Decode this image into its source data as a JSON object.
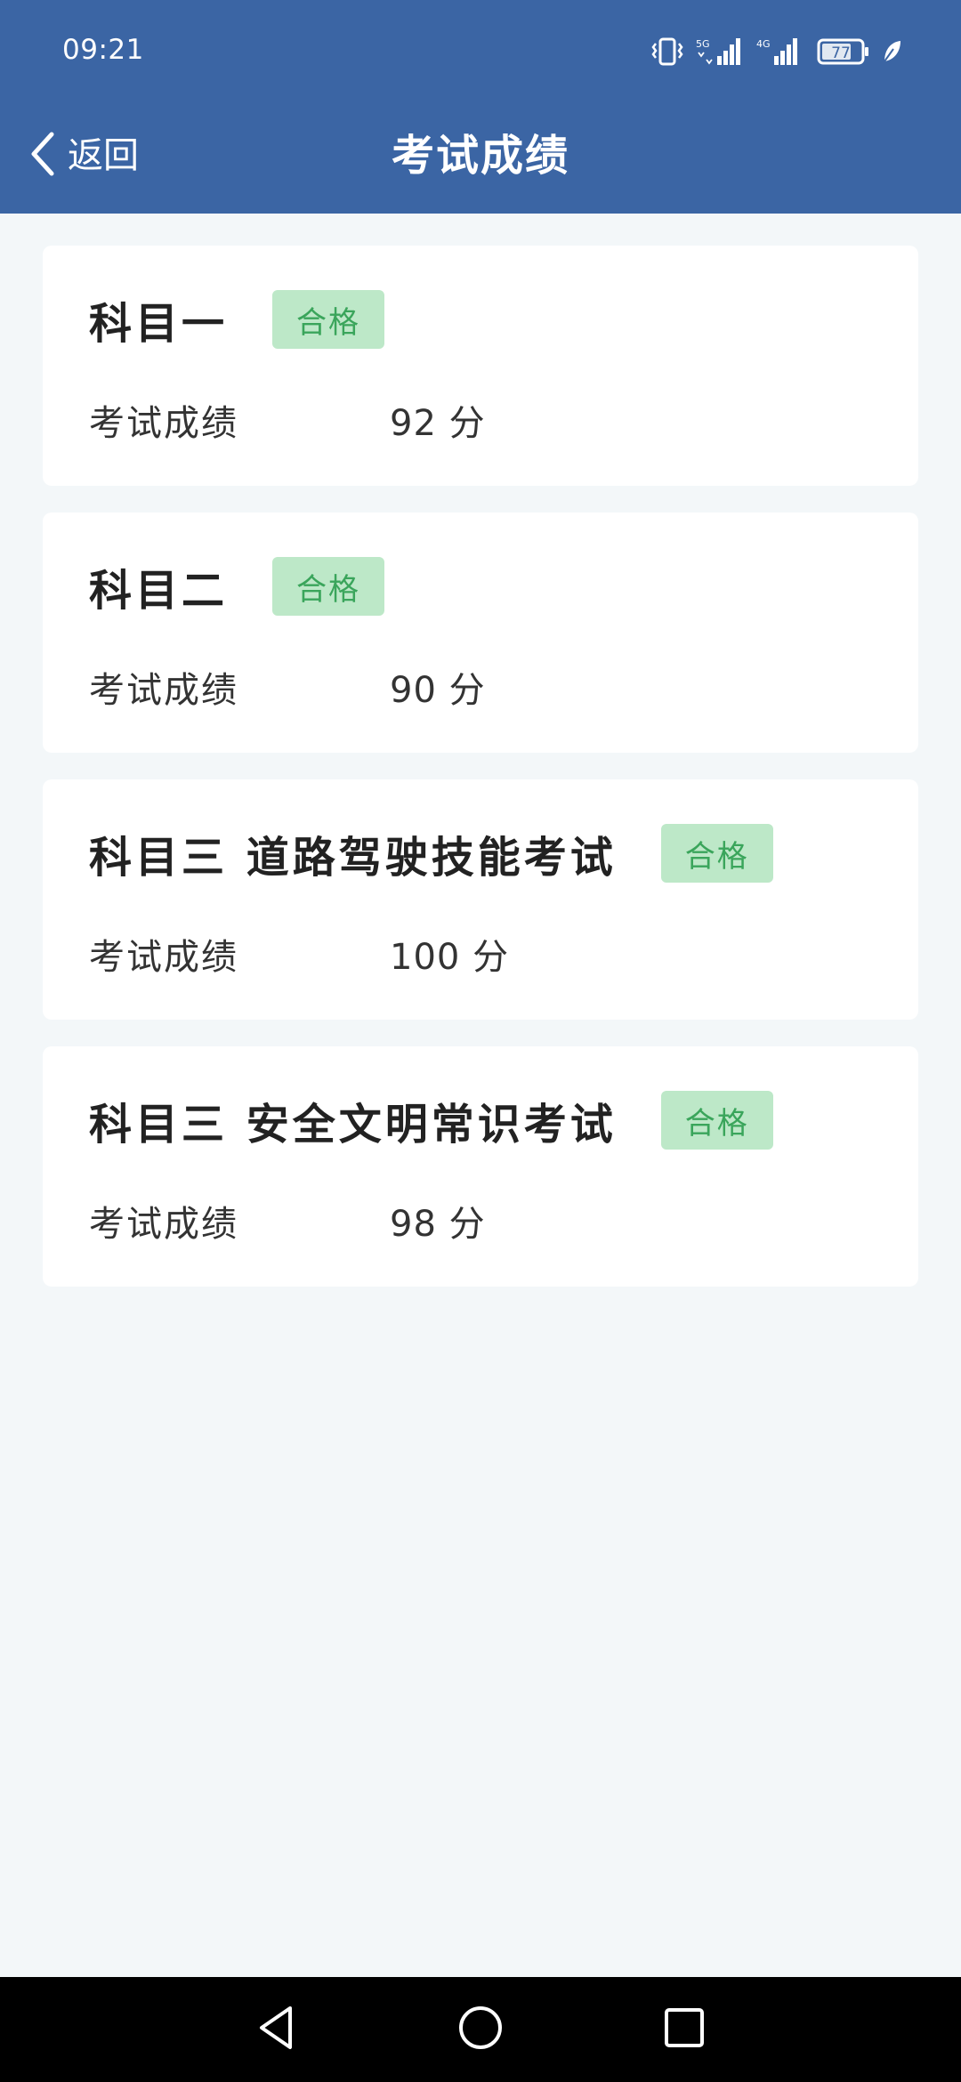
{
  "status_bar": {
    "time": "09:21",
    "battery": "77",
    "net1": "5G",
    "net2": "4G"
  },
  "header": {
    "back_label": "返回",
    "title": "考试成绩"
  },
  "cards": [
    {
      "title": "科目一",
      "badge": "合格",
      "score_label": "考试成绩",
      "score": "92 分"
    },
    {
      "title": "科目二",
      "badge": "合格",
      "score_label": "考试成绩",
      "score": "90 分"
    },
    {
      "title": "科目三 道路驾驶技能考试",
      "badge": "合格",
      "score_label": "考试成绩",
      "score": "100 分"
    },
    {
      "title": "科目三 安全文明常识考试",
      "badge": "合格",
      "score_label": "考试成绩",
      "score": "98 分"
    }
  ],
  "colors": {
    "header_bg": "#3b65a4",
    "page_bg": "#f3f7f9",
    "badge_bg": "#bde8c8",
    "badge_text": "#3aa55b"
  },
  "icons": {
    "back": "chevron-left-icon",
    "vibrate": "vibrate-icon",
    "signal": "signal-icon",
    "battery": "battery-icon",
    "leaf": "leaf-icon",
    "nav_back": "triangle-back-icon",
    "nav_home": "circle-home-icon",
    "nav_recent": "square-recent-icon"
  }
}
